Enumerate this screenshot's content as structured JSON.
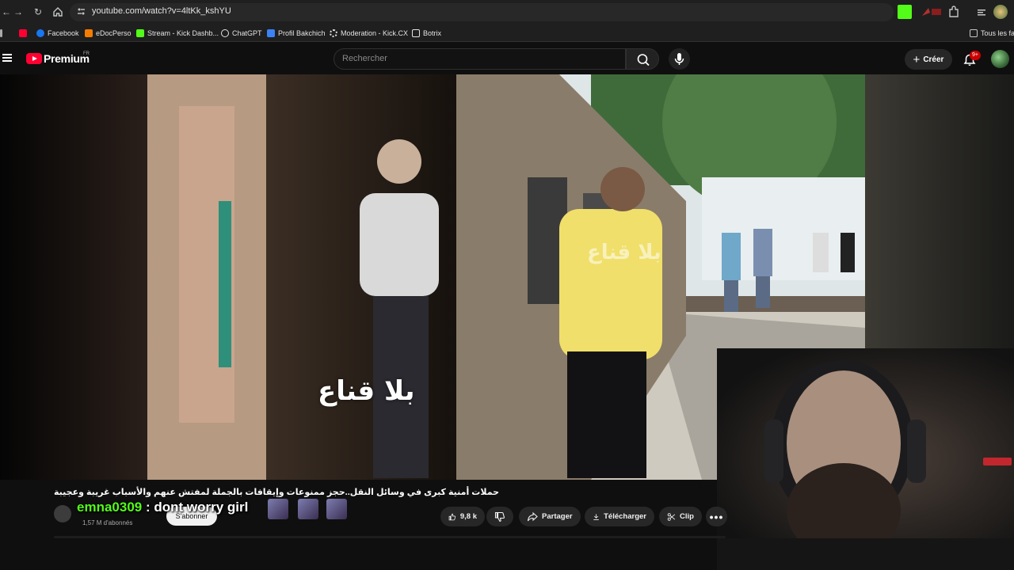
{
  "browser": {
    "url": "youtube.com/watch?v=4ltKk_kshYU",
    "bookmarks": [
      {
        "label": "Facebook",
        "icon": "facebook-icon",
        "color": "#1877f2"
      },
      {
        "label": "eDocPerso",
        "icon": "edocperso-icon",
        "color": "#f57c00"
      },
      {
        "label": "Stream - Kick Dashb...",
        "icon": "kick-icon",
        "color": "#53fc18"
      },
      {
        "label": "ChatGPT",
        "icon": "chatgpt-icon",
        "color": "#e3e3e3"
      },
      {
        "label": "Profil Bakchich",
        "icon": "bakchich-icon",
        "color": "#3b82f6"
      },
      {
        "label": "Moderation - Kick.CX",
        "icon": "gear-icon",
        "color": "#e3e3e3"
      },
      {
        "label": "Botrix",
        "icon": "botrix-icon",
        "color": "#e3e3e3"
      }
    ],
    "all_bookmarks_label": "Tous les fav"
  },
  "youtube": {
    "logo_text": "Premium",
    "country_code": "FR",
    "search_placeholder": "Rechercher",
    "create_label": "Créer",
    "notification_count": "9+"
  },
  "video": {
    "title": "حملات أمنية كبرى في وسائل النقل..حجز ممنوعات وإيقافات بالجملة لمفتش عنهم والأسباب غريبة وعجيبة",
    "watermark": "بلا قناع",
    "subscribers": "1,57 M d'abonnés",
    "subscribe_label": "S'abonner",
    "likes": "9,8 k",
    "share_label": "Partager",
    "download_label": "Télécharger",
    "clip_label": "Clip"
  },
  "overlay": {
    "chat_user": "emna0309",
    "chat_message": " : dont worry girl"
  },
  "colors": {
    "accent_red": "#ff0033",
    "kick_green": "#53fc18",
    "background": "#0f0f0f"
  }
}
